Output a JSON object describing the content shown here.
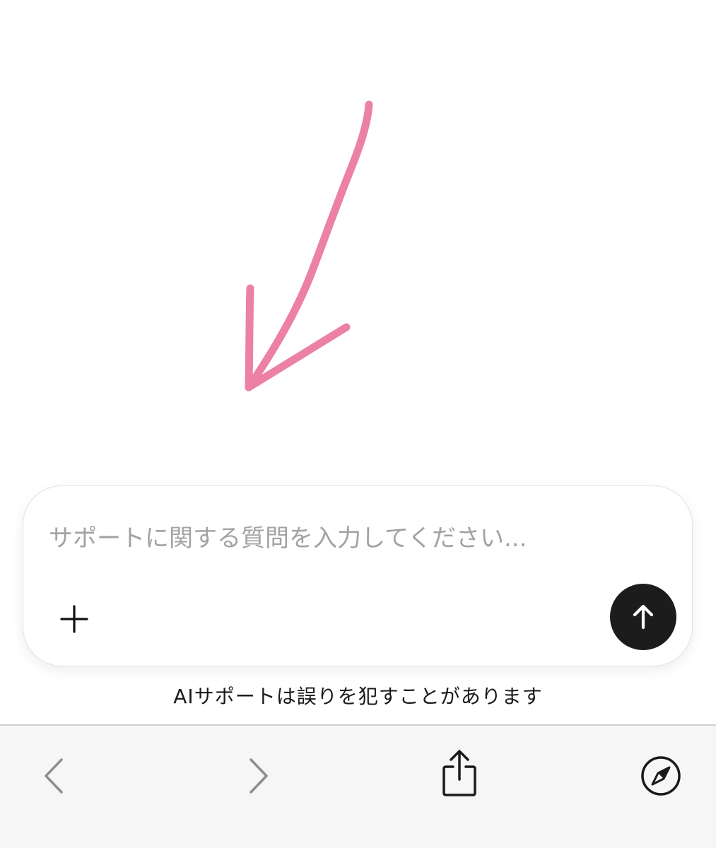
{
  "composer": {
    "placeholder": "サポートに関する質問を入力してください...",
    "value": ""
  },
  "disclaimer": "AIサポートは誤りを犯すことがあります",
  "icons": {
    "annotation": "hand-drawn-arrow-icon",
    "attach": "plus-icon",
    "send": "arrow-up-icon",
    "back": "chevron-left-icon",
    "forward": "chevron-right-icon",
    "share": "share-icon",
    "browser": "compass-icon"
  },
  "colors": {
    "annotation_stroke": "#ec7aa3",
    "send_button": "#1c1c1c",
    "placeholder": "#a2a2a2",
    "toolbar_bg": "#f6f6f6",
    "toolbar_icon_disabled": "#8e8e8e",
    "toolbar_icon": "#1a1a1a"
  }
}
